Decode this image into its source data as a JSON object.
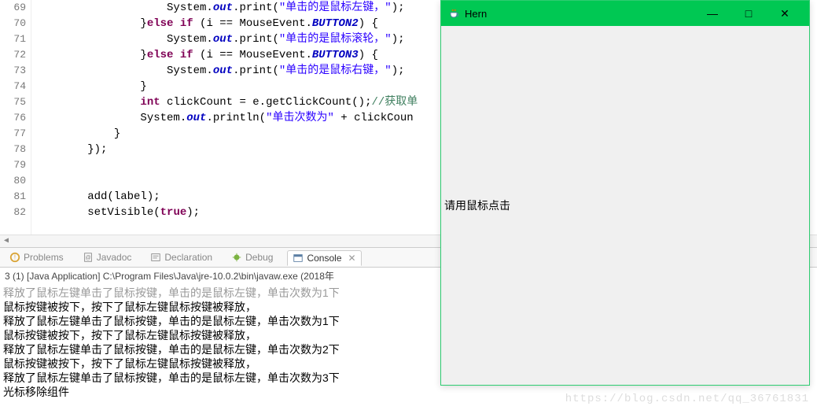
{
  "editor": {
    "lineStart": 69,
    "lines": [
      {
        "indent": 20,
        "html": "System.<span class='field'>out</span>.print(<span class='str'>\"单击的是鼠标左键，\"</span>);"
      },
      {
        "indent": 16,
        "html": "}<span class='kw'>else if</span> (i == MouseEvent.<span class='field'>BUTTON2</span>) {"
      },
      {
        "indent": 20,
        "html": "System.<span class='field'>out</span>.print(<span class='str'>\"单击的是鼠标滚轮，\"</span>);"
      },
      {
        "indent": 16,
        "html": "}<span class='kw'>else if</span> (i == MouseEvent.<span class='field'>BUTTON3</span>) {"
      },
      {
        "indent": 20,
        "html": "System.<span class='field'>out</span>.print(<span class='str'>\"单击的是鼠标右键，\"</span>);"
      },
      {
        "indent": 16,
        "html": "}"
      },
      {
        "indent": 16,
        "html": "<span class='kw'>int</span> clickCount = e.getClickCount();<span class='comment'>//获取单</span>"
      },
      {
        "indent": 16,
        "html": "System.<span class='field'>out</span>.println(<span class='str'>\"单击次数为\"</span> + clickCoun"
      },
      {
        "indent": 12,
        "html": "}"
      },
      {
        "indent": 8,
        "html": "});"
      },
      {
        "indent": 0,
        "html": ""
      },
      {
        "indent": 0,
        "html": ""
      },
      {
        "indent": 8,
        "html": "add(label);"
      },
      {
        "indent": 8,
        "html": "setVisible(<span class='kw'>true</span>);"
      }
    ]
  },
  "tabs": {
    "problems": "Problems",
    "javadoc": "Javadoc",
    "declaration": "Declaration",
    "debug": "Debug",
    "console": "Console"
  },
  "console": {
    "header": "3 (1) [Java Application] C:\\Program Files\\Java\\jre-10.0.2\\bin\\javaw.exe (2018年",
    "fadedLine": "释放了鼠标左键单击了鼠标按键，单击的是鼠标左键，单击次数为1下",
    "lines": [
      "鼠标按键被按下，按下了鼠标左键鼠标按键被释放，",
      "释放了鼠标左键单击了鼠标按键，单击的是鼠标左键，单击次数为1下",
      "鼠标按键被按下，按下了鼠标左键鼠标按键被释放，",
      "释放了鼠标左键单击了鼠标按键，单击的是鼠标左键，单击次数为2下",
      "鼠标按键被按下，按下了鼠标左键鼠标按键被释放，",
      "释放了鼠标左键单击了鼠标按键，单击的是鼠标左键，单击次数为3下",
      "光标移除组件"
    ]
  },
  "appWindow": {
    "title": "Hern",
    "labelText": "请用鼠标点击",
    "controls": {
      "minimize": "—",
      "maximize": "□",
      "close": "✕"
    }
  },
  "watermark": "https://blog.csdn.net/qq_36761831"
}
